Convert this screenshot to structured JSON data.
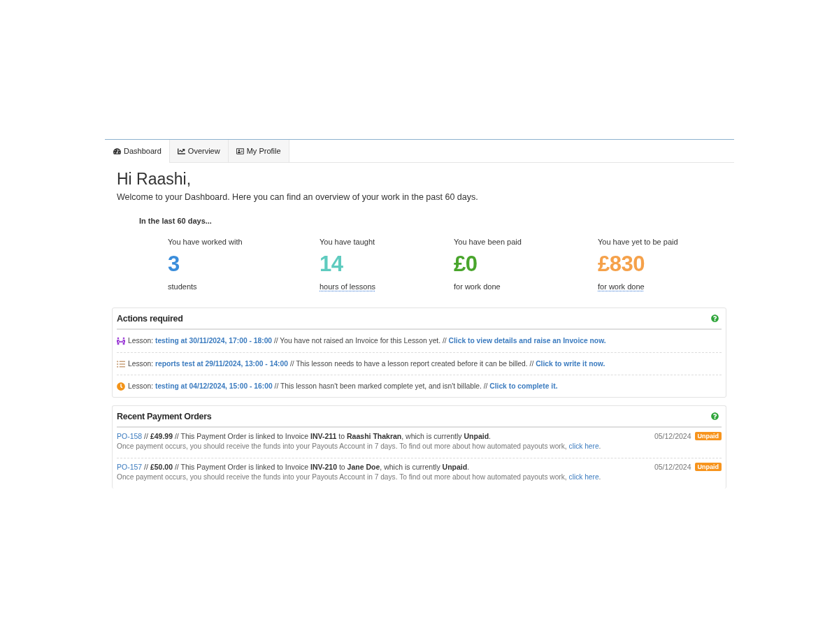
{
  "tabs": [
    {
      "label": "Dashboard",
      "selected": true
    },
    {
      "label": "Overview",
      "selected": false
    },
    {
      "label": "My Profile",
      "selected": false
    }
  ],
  "greeting": "Hi Raashi,",
  "intro": "Welcome to your Dashboard. Here you can find an overview of your work in the past 60 days.",
  "summary": {
    "title": "In the last 60 days...",
    "stats": [
      {
        "label": "You have worked with",
        "value": "3",
        "unit": "students",
        "color": "#3a8ddb",
        "underlined": false
      },
      {
        "label": "You have taught",
        "value": "14",
        "unit": "hours of lessons",
        "color": "#5fcbbf",
        "underlined": true
      },
      {
        "label": "You have been paid",
        "value": "£0",
        "unit": "for work done",
        "color": "#49a52c",
        "underlined": false
      },
      {
        "label": "You have yet to be paid",
        "value": "£830",
        "unit": "for work done",
        "color": "#f5a14a",
        "underlined": true
      }
    ]
  },
  "actions": {
    "title": "Actions required",
    "items": [
      {
        "kind": "invoice",
        "prefix": "Lesson:",
        "lesson": "testing at 30/11/2024, 17:00 - 18:00",
        "message": "// You have not raised an Invoice for this Lesson yet. //",
        "link": "Click to view details and raise an Invoice now."
      },
      {
        "kind": "report",
        "prefix": "Lesson:",
        "lesson": "reports test at 29/11/2024, 13:00 - 14:00",
        "message": "// This lesson needs to have a lesson report created before it can be billed. //",
        "link": "Click to write it now."
      },
      {
        "kind": "complete",
        "prefix": "Lesson:",
        "lesson": "testing at 04/12/2024, 15:00 - 16:00",
        "message": "// This lesson hasn't been marked complete yet, and isn't billable. //",
        "link": "Click to complete it."
      }
    ]
  },
  "payment_orders": {
    "title": "Recent Payment Orders",
    "items": [
      {
        "id": "PO-158",
        "summary": "// **£49.99** // This Payment Order is linked to Invoice **INV-211** to **Raashi Thakran**, which is currently **Unpaid**.",
        "note": "Once payment occurs, you should receive the funds into your Payouts Account in 7 days. To find out more about how automated payouts work,",
        "note_link": "click here",
        "note_end": ".",
        "date": "05/12/2024",
        "status": {
          "label": "Unpaid",
          "kind": "warning"
        }
      },
      {
        "id": "PO-157",
        "summary": "// **£50.00** // This Payment Order is linked to Invoice **INV-210** to **Jane Doe**, which is currently **Unpaid**.",
        "note": "Once payment occurs, you should receive the funds into your Payouts Account in 7 days. To find out more about how automated payouts work,",
        "note_link": "click here",
        "note_end": ".",
        "date": "05/12/2024",
        "status": {
          "label": "Unpaid",
          "kind": "warning"
        }
      }
    ]
  }
}
